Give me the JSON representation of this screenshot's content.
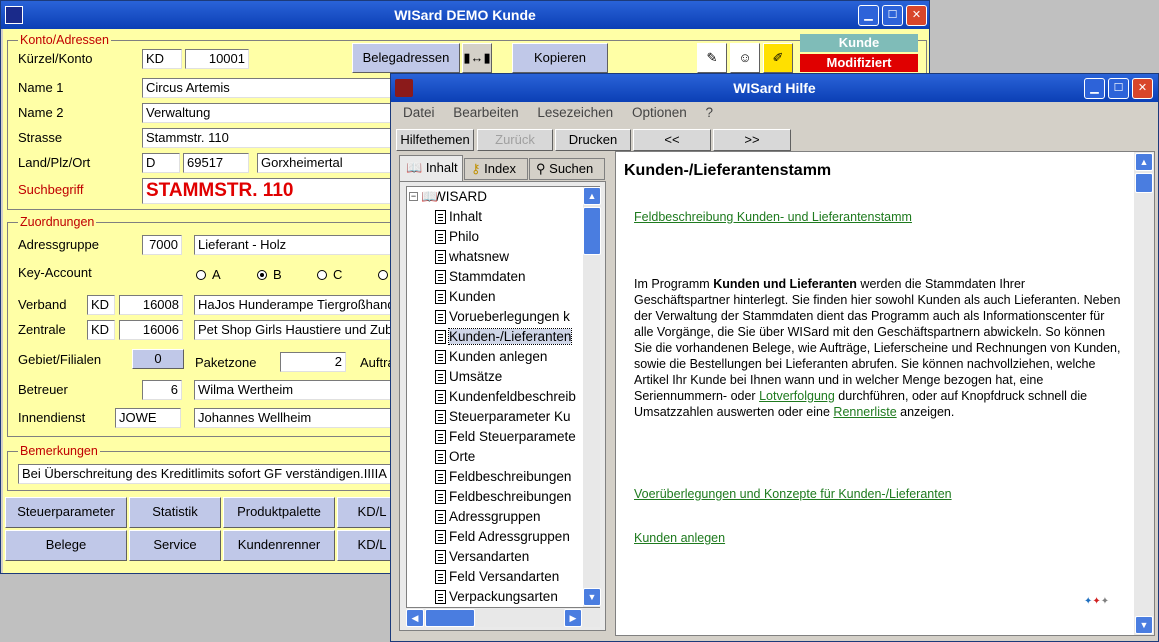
{
  "main": {
    "title": "WISard DEMO Kunde",
    "konto": {
      "group": "Konto/Adressen",
      "kuerzel_label": "Kürzel/Konto",
      "kuerzel_code": "KD",
      "kuerzel_nr": "10001",
      "name1_label": "Name 1",
      "name1": "Circus Artemis",
      "name2_label": "Name 2",
      "name2": "Verwaltung",
      "strasse_label": "Strasse",
      "strasse": "Stammstr. 110",
      "ort_label": "Land/Plz/Ort",
      "land": "D",
      "plz": "69517",
      "ort": "Gorxheimertal",
      "such_label": "Suchbegriff",
      "such": "STAMMSTR. 110",
      "belegadressen": "Belegadressen",
      "kopieren": "Kopieren",
      "status_kunde": "Kunde",
      "status_mod": "Modifiziert"
    },
    "zuord": {
      "group": "Zuordnungen",
      "adressgruppe_label": "Adressgruppe",
      "adressgruppe_nr": "7000",
      "adressgruppe": "Lieferant - Holz",
      "key_label": "Key-Account",
      "key_a": "A",
      "key_b": "B",
      "key_c": "C",
      "verband_label": "Verband",
      "verband_code": "KD",
      "verband_nr": "16008",
      "verband": "HaJos Hunderampe Tiergroßhandel",
      "zentrale_label": "Zentrale",
      "zentrale_code": "KD",
      "zentrale_nr": "16006",
      "zentrale": "Pet Shop Girls Haustiere und Zubehör",
      "gebiet_label": "Gebiet/Filialen",
      "gebiet": "0",
      "paket_label": "Paketzone",
      "paket": "2",
      "auftr_label": "Auftra",
      "betreuer_label": "Betreuer",
      "betreuer_nr": "6",
      "betreuer": "Wilma Wertheim",
      "innen_label": "Innendienst",
      "innen_code": "JOWE",
      "innen": "Johannes Wellheim"
    },
    "bem": {
      "group": "Bemerkungen",
      "text": "Bei Überschreitung des Kreditlimits sofort GF verständigen.IIIIA"
    },
    "buttons": {
      "steuer": "Steuerparameter",
      "statistik": "Statistik",
      "produkt": "Produktpalette",
      "kdl1": "KD/L",
      "belege": "Belege",
      "service": "Service",
      "renner": "Kundenrenner",
      "kdl2": "KD/L"
    }
  },
  "help": {
    "title": "WISard Hilfe",
    "menu": [
      "Datei",
      "Bearbeiten",
      "Lesezeichen",
      "Optionen",
      "?"
    ],
    "toolbar": {
      "themen": "Hilfethemen",
      "zurueck": "Zurück",
      "drucken": "Drucken",
      "prev": "<<",
      "next": ">>"
    },
    "tabs": {
      "inhalt": "Inhalt",
      "index": "Index",
      "suchen": "Suchen"
    },
    "tree_root": "WISARD",
    "tree": [
      "Inhalt",
      "Philo",
      "whatsnew",
      "Stammdaten",
      "Kunden",
      "Vorueberlegungen k",
      "Kunden-/Lieferanten",
      "Kunden anlegen",
      "Umsätze",
      "Kundenfeldbeschreib",
      "Steuerparameter Ku",
      "Feld Steuerparamete",
      "Orte",
      "Feldbeschreibungen",
      "Feldbeschreibungen",
      "Adressgruppen",
      "Feld Adressgruppen",
      "Versandarten",
      "Feld Versandarten",
      "Verpackungsarten"
    ],
    "content": {
      "heading": "Kunden-/Lieferantenstamm",
      "link1": "Feldbeschreibung Kunden- und Lieferantenstamm",
      "p_a": "Im Programm ",
      "p_bold": "Kunden und Lieferanten",
      "p_b": " werden die Stammdaten Ihrer Geschäftspartner hinterlegt. Sie finden hier sowohl Kunden als auch Lieferanten. Neben der Verwaltung der Stammdaten dient das Programm auch als Informationscenter für alle Vorgänge, die Sie über WISard mit den Geschäftspartnern abwickeln. So können Sie die vorhandenen Belege, wie Aufträge, Lieferscheine und Rechnungen von Kunden, sowie die Bestellungen bei Lieferanten abrufen. Sie können nachvollziehen, welche Artikel Ihr Kunde bei Ihnen wann und in welcher Menge bezogen hat, eine Seriennummern- oder ",
      "p_link1": "Lotverfolgung",
      "p_c": " durchführen, oder auf Knopfdruck schnell die Umsatzzahlen auswerten oder eine ",
      "p_link2": "Rennerliste",
      "p_d": " anzeigen.",
      "link2": "Voerüberlegungen und Konzepte für Kunden-/Lieferanten",
      "link3": "Kunden anlegen"
    },
    "colors": {
      "link": "#1e7a1e",
      "accent": "#c00000"
    }
  }
}
